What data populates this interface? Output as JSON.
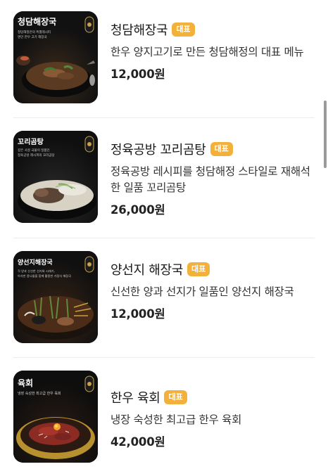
{
  "menu": {
    "items": [
      {
        "name": "청담해장국",
        "badge": "대표",
        "description": "한우 양지고기로 만든 청담해정의 대표 메뉴",
        "price": "12,000원",
        "image": {
          "title": "청담해장국",
          "subtitle_1": "청담해정만의 특별레시피",
          "subtitle_2": "명인 한우 고기 해장국"
        }
      },
      {
        "name": "정육공방 꼬리곰탕",
        "badge": "대표",
        "description": "정육공방 레시피를 청담해정 스타일로 재해석한 일품 꼬리곰탕",
        "price": "26,000원",
        "image": {
          "title": "꼬리곰탕",
          "subtitle_1": "깊은 사골 국물이 일품인",
          "subtitle_2": "정육공방 레시피의 꼬리곰탕"
        }
      },
      {
        "name": "양선지 해장국",
        "badge": "대표",
        "description": "신선한 양과 선지가 일품인 양선지 해장국",
        "price": "12,000원",
        "image": {
          "title": "양선지해장국",
          "subtitle_1": "각 양과 신선한 선지와 시래기,",
          "subtitle_2": "아삭한 콩나물을 함께 활용한 가정식 해장국"
        }
      },
      {
        "name": "한우 육회",
        "badge": "대표",
        "description": "냉장 숙성한 최고급 한우 육회",
        "price": "42,000원",
        "image": {
          "title": "육회",
          "subtitle_1": "냉장 숙성한 최고급 한우 육회",
          "subtitle_2": ""
        }
      }
    ]
  },
  "colors": {
    "badge": "#f2b13a",
    "thumb_bg": "#141414",
    "divider": "#ececec"
  },
  "icons": {
    "logo_mark": "lantern-logo-icon"
  }
}
